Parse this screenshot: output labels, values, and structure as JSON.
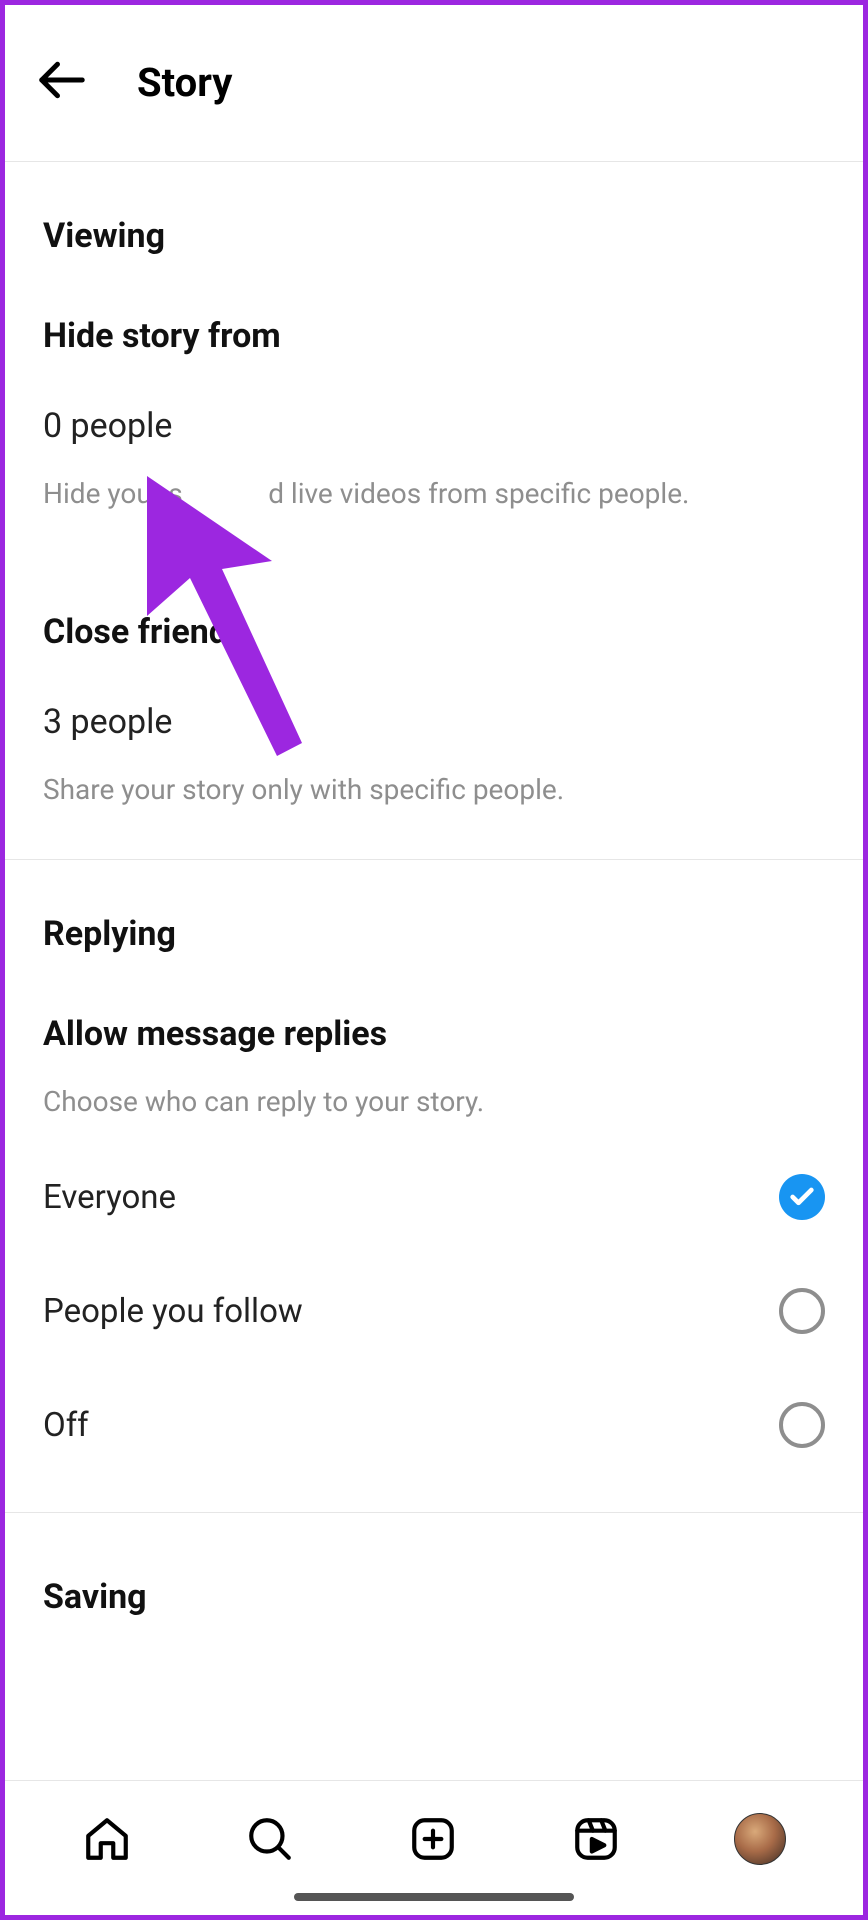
{
  "header": {
    "title": "Story"
  },
  "sections": {
    "viewing": {
      "title": "Viewing",
      "hide_story": {
        "label": "Hide story from",
        "value": "0 people",
        "desc_a": "Hide your s",
        "desc_b": "d live videos from specific people."
      },
      "close_friends": {
        "label": "Close friends",
        "value": "3 people",
        "desc": "Share your story only with specific people."
      }
    },
    "replying": {
      "title": "Replying",
      "allow_replies": {
        "label": "Allow message replies",
        "desc": "Choose who can reply to your story.",
        "options": [
          {
            "label": "Everyone",
            "selected": true
          },
          {
            "label": "People you follow",
            "selected": false
          },
          {
            "label": "Off",
            "selected": false
          }
        ]
      }
    },
    "saving": {
      "title": "Saving"
    }
  }
}
